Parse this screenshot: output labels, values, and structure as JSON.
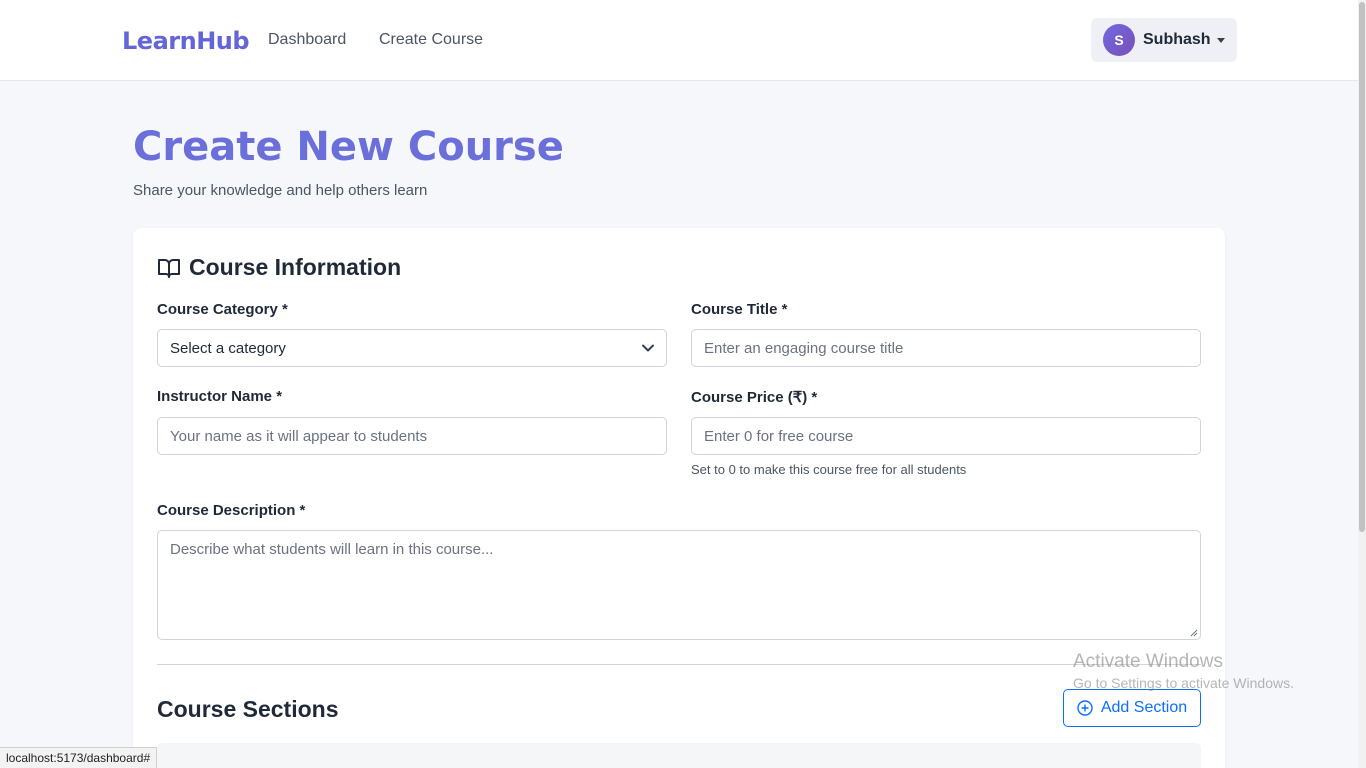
{
  "navbar": {
    "brand": "LearnHub",
    "links": [
      "Dashboard",
      "Create Course"
    ],
    "user": {
      "initial": "S",
      "name": "Subhash"
    }
  },
  "page": {
    "title": "Create New Course",
    "subtitle": "Share your knowledge and help others learn"
  },
  "course_info": {
    "heading": "Course Information",
    "category": {
      "label": "Course Category *",
      "value": "Select a category"
    },
    "title": {
      "label": "Course Title *",
      "placeholder": "Enter an engaging course title"
    },
    "instructor": {
      "label": "Instructor Name *",
      "placeholder": "Your name as it will appear to students"
    },
    "price": {
      "label": "Course Price (₹) *",
      "placeholder": "Enter 0 for free course",
      "hint": "Set to 0 to make this course free for all students"
    },
    "description": {
      "label": "Course Description *",
      "placeholder": "Describe what students will learn in this course..."
    }
  },
  "sections": {
    "heading": "Course Sections",
    "add_label": "Add Section"
  },
  "watermark": {
    "title": "Activate Windows",
    "subtitle": "Go to Settings to activate Windows."
  },
  "status_bar": {
    "url": "localhost:5173/dashboard#"
  },
  "colors": {
    "brand": "#6366d6",
    "primary": "#0d6efd",
    "background": "#f5f7fb"
  }
}
